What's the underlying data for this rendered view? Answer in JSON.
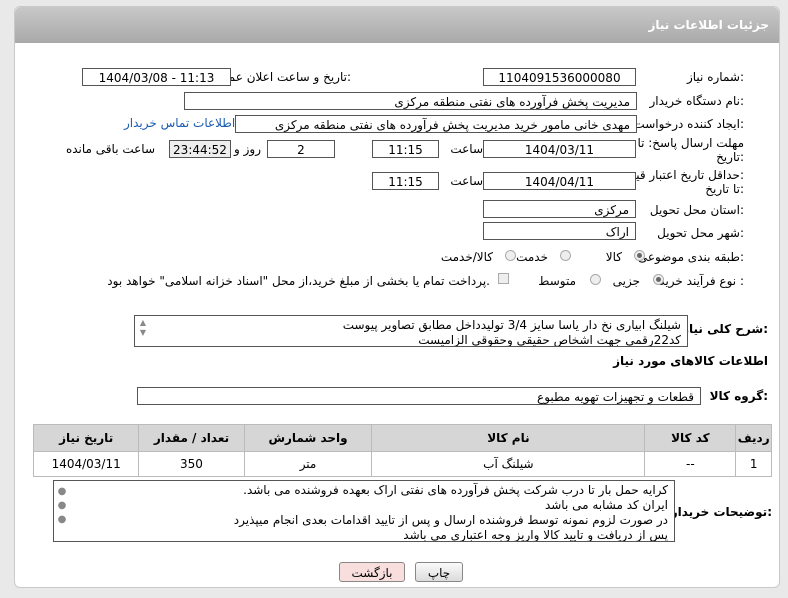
{
  "header": {
    "title": "جزئیات اطلاعات نیاز"
  },
  "need_number": {
    "label": "شماره نیاز:",
    "value": "1104091536000080"
  },
  "announce_datetime": {
    "label": "تاریخ و ساعت اعلان عمومی:",
    "value": "1404/03/08 - 11:13"
  },
  "buyer_org": {
    "label": "نام دستگاه خریدار:",
    "value": "مدیریت پخش فرآورده های نفتی منطقه مرکزی"
  },
  "requester": {
    "label": "ایجاد کننده درخواست:",
    "value": "مهدی خانی مامور خرید مدیریت پخش فرآورده های نفتی منطقه مرکزی",
    "contact_link": "اطلاعات تماس خریدار"
  },
  "reply_deadline": {
    "label_line1": "مهلت ارسال پاسخ: تا",
    "label_line2": "تاریخ:",
    "date": "1404/03/11",
    "time_label": "ساعت",
    "time": "11:15",
    "days": "2",
    "days_label": "روز و",
    "remaining": "23:44:52",
    "remaining_label": "ساعت باقی مانده"
  },
  "price_validity": {
    "label_line1": "حداقل تاریخ اعتبار قیمت:",
    "label_line2": "تا تاریخ:",
    "date": "1404/04/11",
    "time_label": "ساعت",
    "time": "11:15"
  },
  "province": {
    "label": "استان محل تحویل:",
    "value": "مرکزی"
  },
  "city": {
    "label": "شهر محل تحویل:",
    "value": "اراک"
  },
  "category": {
    "label": "طبقه بندی موضوعی:",
    "options": [
      "کالا",
      "خدمت",
      "کالا/خدمت"
    ],
    "selected": "کالا"
  },
  "process_type": {
    "label": "نوع فرآیند خرید :",
    "options": [
      "جزیی",
      "متوسط"
    ],
    "selected": "جزیی",
    "note": "پرداخت تمام یا بخشی از مبلغ خرید،از محل \"اسناد خزانه اسلامی\" خواهد بود."
  },
  "description": {
    "label": "شرح کلی نیاز:",
    "line1": "شیلنگ ابیاری  نخ دار  یاسا سایز 3/4 تولیدداخل مطابق تصاویر پیوست",
    "line2": "کد22رقمی  جهت اشخاص حقیقی وحقوقی الزامیست"
  },
  "goods_info": {
    "title": "اطلاعات کالاهای مورد نیاز"
  },
  "goods_group": {
    "label": "گروه کالا:",
    "value": "قطعات و تجهیزات تهویه مطبوع"
  },
  "table": {
    "headers": [
      "ردیف",
      "کد کالا",
      "نام کالا",
      "واحد شمارش",
      "تعداد / مقدار",
      "تاریخ نیاز"
    ],
    "rows": [
      {
        "index": "1",
        "code": "--",
        "name": "شیلنگ آب",
        "unit": "متر",
        "qty": "350",
        "date": "1404/03/11"
      }
    ]
  },
  "buyer_notes": {
    "label": "توضیحات خریدار:",
    "lines": [
      "کرایه حمل بار تا درب شرکت  پخش فرآورده های نفتی اراک بعهده فروشنده می باشد.",
      "ایران کد مشابه می باشد",
      "در صورت لزوم نمونه توسط فروشنده ارسال و پس از تایید اقدامات بعدی انجام میپذیرد",
      "پس از دریافت و تایید کالا واریز وجه اعتباری می باشد"
    ]
  },
  "buttons": {
    "print": "چاپ",
    "back": "بازگشت"
  },
  "colors": {
    "header_bg": "#b0b0b0",
    "link": "#1a5cb0",
    "back_button_bg": "#f9dede"
  }
}
